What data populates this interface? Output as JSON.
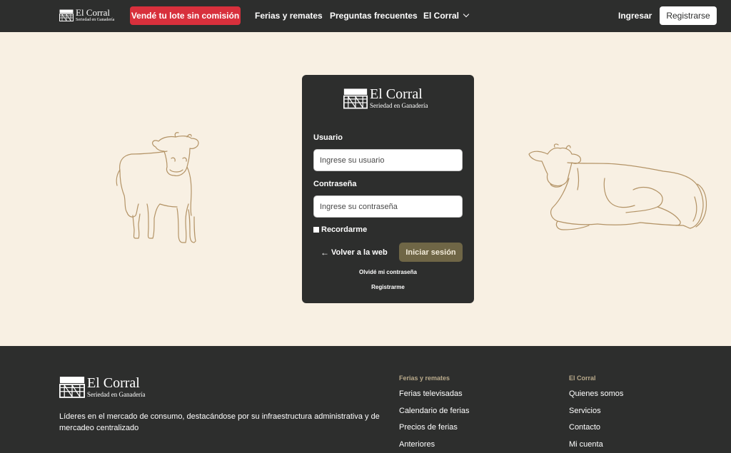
{
  "brand": {
    "name": "El Corral",
    "tagline": "Seriedad en Ganadería",
    "mark_text": "El Corral"
  },
  "header": {
    "cta": "Vendé tu lote sin comisión",
    "nav": {
      "ferias": "Ferias y remates",
      "preguntas": "Preguntas frecuentes",
      "corral": "El Corral"
    },
    "ingresar": "Ingresar",
    "registrarse": "Registrarse"
  },
  "login": {
    "user_label": "Usuario",
    "user_placeholder": "Ingrese su usuario",
    "pass_label": "Contraseña",
    "pass_placeholder": "Ingrese su contraseña",
    "remember": "Recordarme",
    "back": "Volver a la web",
    "submit": "Iniciar sesión",
    "forgot": "Olvidé mi contraseña",
    "register": "Registrarme"
  },
  "footer": {
    "description": "Líderes en el mercado de consumo, destacándose por su infraestructura administrativa y de mercadeo centralizado",
    "columns": [
      {
        "title": "Ferias y remates",
        "items": [
          "Ferias televisadas",
          "Calendario de ferias",
          "Precios de ferias",
          "Anteriores"
        ]
      },
      {
        "title": "El Corral",
        "items": [
          "Quienes somos",
          "Servicios",
          "Contacto",
          "Mi cuenta"
        ]
      }
    ]
  },
  "colors": {
    "background": "#f8f0e3",
    "dark": "#2d2e2d",
    "cta_red": "#d8303c",
    "login_button": "#6f6646",
    "cow_line": "#b39366"
  }
}
